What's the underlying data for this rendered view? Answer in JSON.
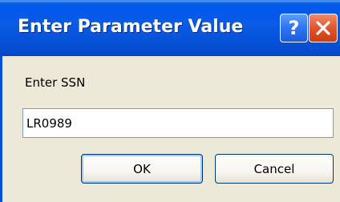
{
  "window": {
    "title": "Enter Parameter Value",
    "help_icon": "question-mark-icon",
    "close_icon": "close-x-icon"
  },
  "form": {
    "prompt_label": "Enter SSN",
    "ssn_value": "LR0989"
  },
  "buttons": {
    "ok_label": "OK",
    "cancel_label": "Cancel"
  },
  "colors": {
    "titlebar": "#0551d6",
    "client_bg": "#ece9d8",
    "close_button": "#e2552c",
    "help_button": "#2f74f0"
  }
}
